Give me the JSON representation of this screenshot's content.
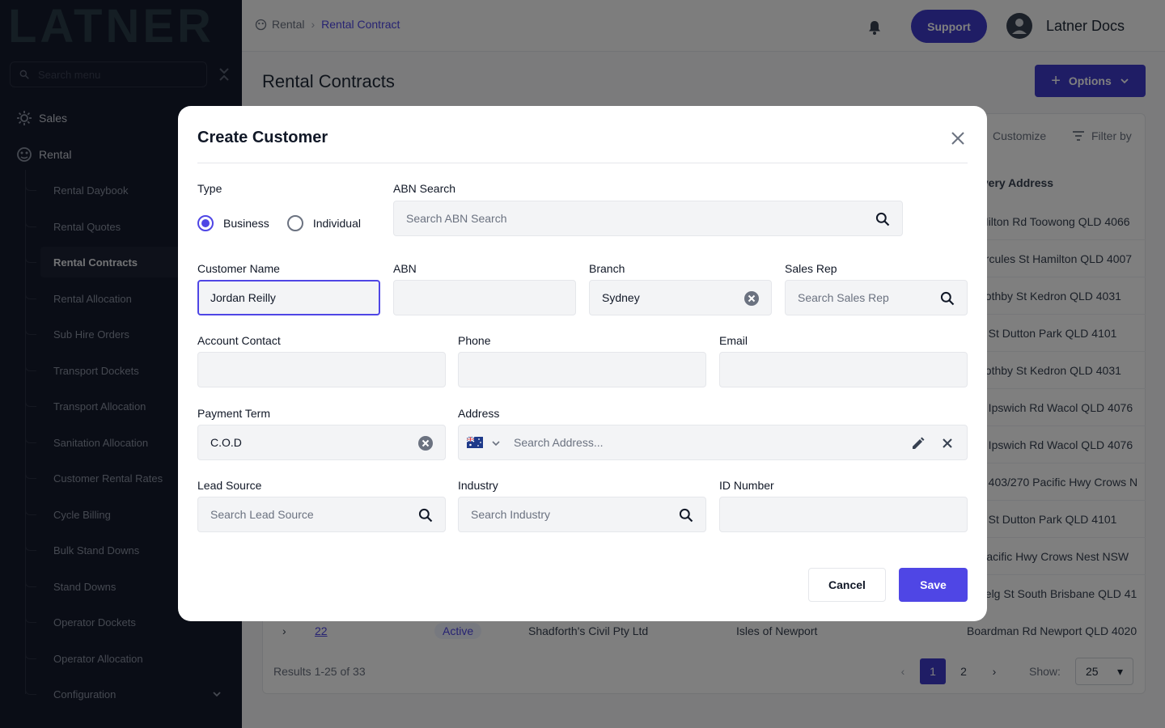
{
  "app": {
    "logo_text": "LATNER"
  },
  "sidebar": {
    "search_placeholder": "Search menu",
    "top_items": [
      {
        "label": "Sales",
        "icon": "sales-icon"
      },
      {
        "label": "Rental",
        "icon": "rental-icon"
      }
    ],
    "rental_children": [
      {
        "label": "Rental Daybook"
      },
      {
        "label": "Rental Quotes"
      },
      {
        "label": "Rental Contracts",
        "active": true
      },
      {
        "label": "Rental Allocation"
      },
      {
        "label": "Sub Hire Orders"
      },
      {
        "label": "Transport Dockets"
      },
      {
        "label": "Transport Allocation"
      },
      {
        "label": "Sanitation Allocation"
      },
      {
        "label": "Customer Rental Rates"
      },
      {
        "label": "Cycle Billing"
      },
      {
        "label": "Bulk Stand Downs"
      },
      {
        "label": "Stand Downs"
      },
      {
        "label": "Operator Dockets"
      },
      {
        "label": "Operator Allocation"
      },
      {
        "label": "Configuration"
      }
    ]
  },
  "header": {
    "breadcrumb": {
      "root": "Rental",
      "current": "Rental Contract"
    },
    "support_label": "Support",
    "user_name": "Latner Docs"
  },
  "page": {
    "title": "Rental Contracts",
    "options_label": "Options",
    "customize_label": "Customize",
    "filter_label": "Filter by",
    "column_header": "ivery Address",
    "addresses": [
      "Milton Rd Toowong QLD 4066",
      "ercules St Hamilton QLD 4007",
      "oothby St Kedron QLD 4031",
      "n St Dutton Park QLD 4101",
      "oothby St Kedron QLD 4031",
      "3 Ipswich Rd Wacol QLD 4076",
      "3 Ipswich Rd Wacol QLD 4076",
      "e 403/270 Pacific Hwy Crows N",
      "n St Dutton Park QLD 4101",
      "Pacific Hwy Crows Nest NSW",
      "nelg St South Brisbane QLD 41"
    ],
    "last_row": {
      "id": "22",
      "status": "Active",
      "customer": "Shadforth's Civil Pty Ltd",
      "site": "Isles of Newport",
      "address": "Boardman Rd Newport QLD 4020"
    },
    "results_text": "Results 1-25 of 33",
    "pages": [
      "1",
      "2"
    ],
    "show_label": "Show:",
    "show_value": "25"
  },
  "modal": {
    "title": "Create Customer",
    "type_label": "Type",
    "type_options": [
      "Business",
      "Individual"
    ],
    "type_selected": "Business",
    "abn_search": {
      "label": "ABN Search",
      "placeholder": "Search ABN Search"
    },
    "customer_name": {
      "label": "Customer Name",
      "value": "Jordan Reilly"
    },
    "abn": {
      "label": "ABN",
      "value": ""
    },
    "branch": {
      "label": "Branch",
      "value": "Sydney"
    },
    "sales_rep": {
      "label": "Sales Rep",
      "placeholder": "Search Sales Rep"
    },
    "account_contact": {
      "label": "Account Contact",
      "value": ""
    },
    "phone": {
      "label": "Phone",
      "value": ""
    },
    "email": {
      "label": "Email",
      "value": ""
    },
    "payment_term": {
      "label": "Payment Term",
      "value": "C.O.D"
    },
    "address": {
      "label": "Address",
      "placeholder": "Search Address..."
    },
    "lead_source": {
      "label": "Lead Source",
      "placeholder": "Search Lead Source"
    },
    "industry": {
      "label": "Industry",
      "placeholder": "Search Industry"
    },
    "id_number": {
      "label": "ID Number",
      "value": ""
    },
    "cancel_label": "Cancel",
    "save_label": "Save"
  },
  "colors": {
    "accent": "#4f46e5",
    "sidebar_bg": "#151a2c",
    "primary_button": "#3f3acb"
  }
}
